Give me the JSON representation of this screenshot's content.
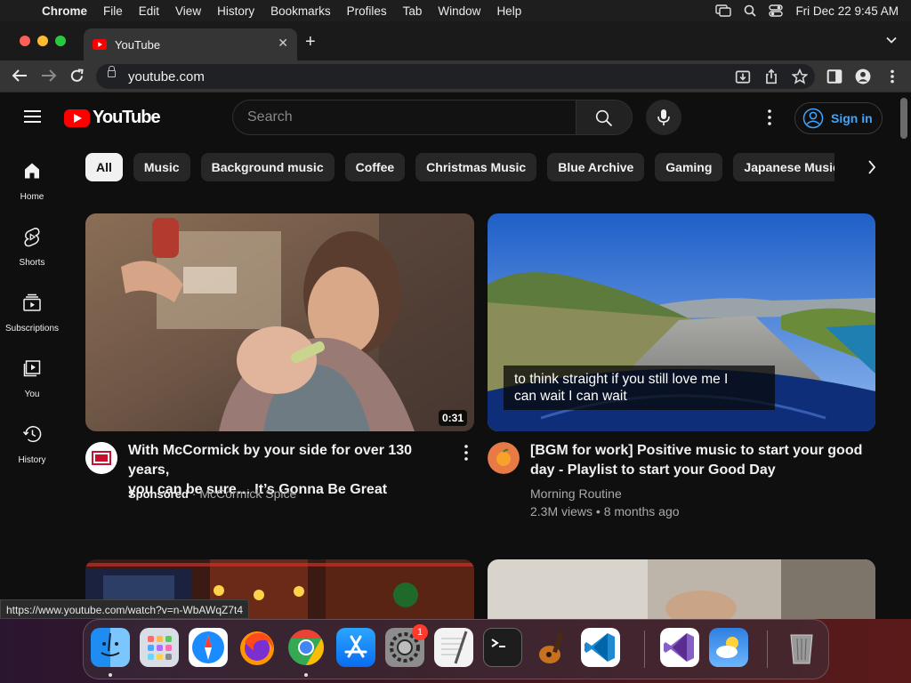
{
  "menubar": {
    "app_name": "Chrome",
    "items": [
      "File",
      "Edit",
      "View",
      "History",
      "Bookmarks",
      "Profiles",
      "Tab",
      "Window",
      "Help"
    ],
    "clock": "Fri Dec 22  9:45 AM"
  },
  "browser": {
    "tab_title": "YouTube",
    "url": "youtube.com",
    "status_url": "https://www.youtube.com/watch?v=n-WbAWqZ7t4"
  },
  "youtube": {
    "logo_text": "YouTube",
    "search_placeholder": "Search",
    "sign_in_label": "Sign in",
    "sidebar": [
      {
        "label": "Home",
        "icon": "home-icon"
      },
      {
        "label": "Shorts",
        "icon": "shorts-icon"
      },
      {
        "label": "Subscriptions",
        "icon": "subscriptions-icon"
      },
      {
        "label": "You",
        "icon": "you-icon"
      },
      {
        "label": "History",
        "icon": "history-icon"
      }
    ],
    "chips": [
      "All",
      "Music",
      "Background music",
      "Coffee",
      "Christmas Music",
      "Blue Archive",
      "Gaming",
      "Japanese Music"
    ],
    "videos": [
      {
        "title_line1": "With McCormick by your side for over 130 years,",
        "title_line2": "you can be sure… It’s Gonna Be Great",
        "sponsored": "Sponsored",
        "separator": "·",
        "channel": "McCormick Spice",
        "duration": "0:31"
      },
      {
        "title_line1": "[BGM for work] Positive music to start your good",
        "title_line2": "day - Playlist to start your Good Day",
        "channel": "Morning Routine",
        "stats": "2.3M views • 8 months ago",
        "caption_line1": "to think straight if you still love me I",
        "caption_line2": "can wait I can wait"
      }
    ]
  },
  "dock": {
    "apps": [
      "Finder",
      "Launchpad",
      "Safari",
      "Firefox",
      "Chrome",
      "App Store",
      "System Settings",
      "TextEdit",
      "Terminal",
      "Instruments",
      "Visual Studio Code",
      "Visual Studio",
      "Weather",
      "Trash"
    ],
    "settings_badge": "1"
  },
  "colors": {
    "youtube_red": "#ff0000",
    "link_blue": "#3ea6ff",
    "background": "#0f0f0f"
  }
}
